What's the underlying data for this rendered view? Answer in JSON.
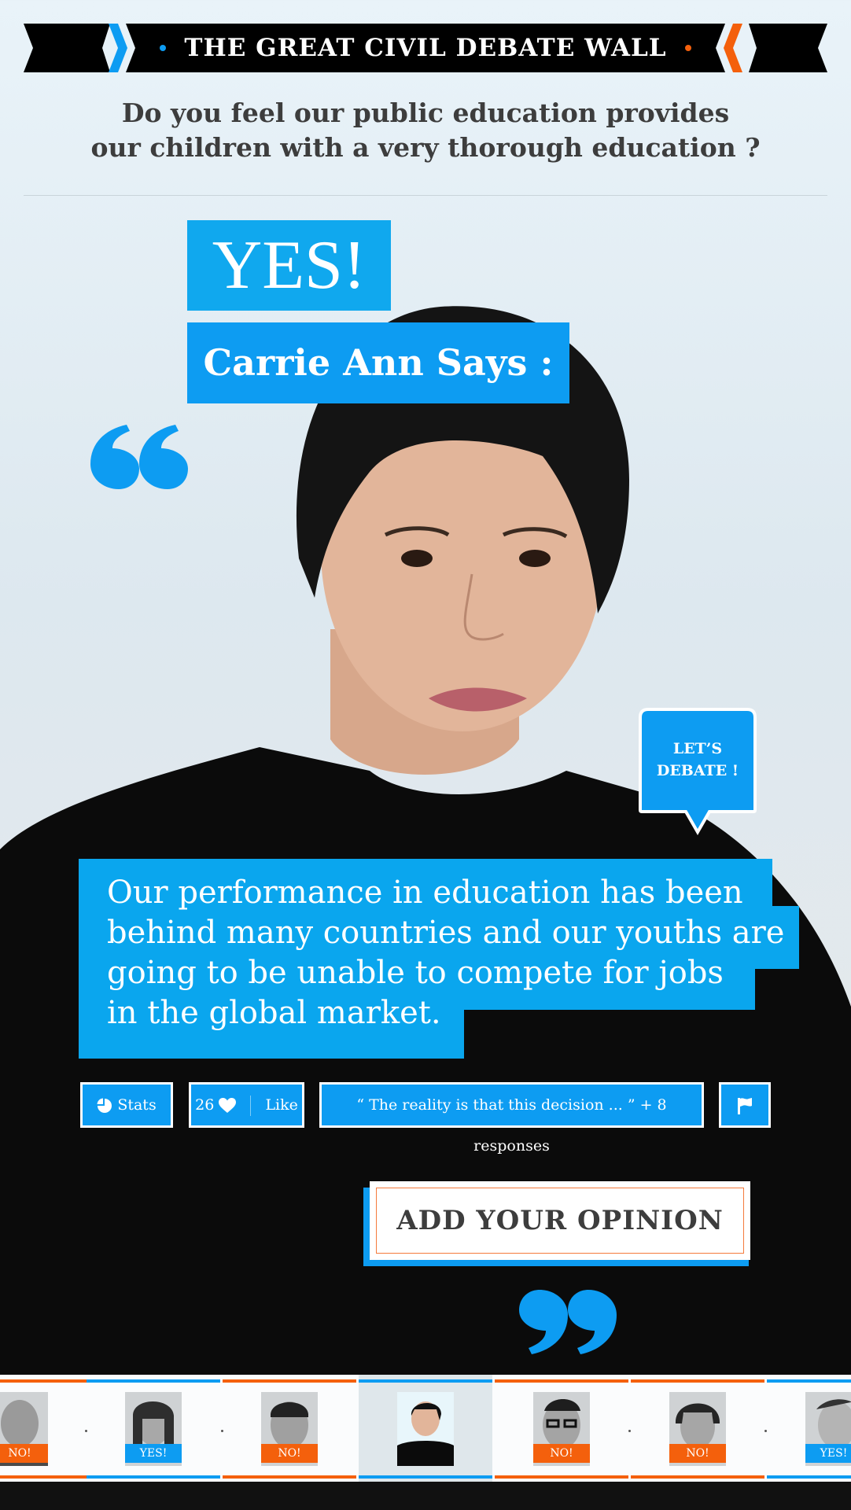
{
  "header": {
    "title": "THE GREAT CIVIL DEBATE WALL",
    "question_line1": "Do you feel our public education provides",
    "question_line2": "our children with a very thorough education ?"
  },
  "debate": {
    "stance": "YES!",
    "speaker": "Carrie Ann Says :",
    "opinion_line1": "Our performance in education has been",
    "opinion_line2": "behind many countries and our youths are",
    "opinion_line3": "going to be unable to compete for jobs",
    "opinion_line4": "in the global market.",
    "debate_bubble_line1": "LET’S",
    "debate_bubble_line2": "DEBATE !"
  },
  "actions": {
    "stats_label": "Stats",
    "like_count": "26",
    "like_label": "Like",
    "responses_label": "“ The reality is that this decision ... ” + 8 responses",
    "add_opinion_label": "ADD YOUR OPINION"
  },
  "thumbnails": [
    {
      "badge": "NO!",
      "stance": "no"
    },
    {
      "badge": "YES!",
      "stance": "yes"
    },
    {
      "badge": "NO!",
      "stance": "no"
    },
    {
      "badge": "",
      "stance": "active"
    },
    {
      "badge": "NO!",
      "stance": "no"
    },
    {
      "badge": "NO!",
      "stance": "no"
    },
    {
      "badge": "YES!",
      "stance": "yes"
    }
  ],
  "colors": {
    "accent_blue": "#0d9cf2",
    "accent_orange": "#f4600c",
    "text_dark": "#3d3d3d",
    "banner_black": "#000000"
  },
  "icons": [
    "stats-pie-icon",
    "heart-icon",
    "flag-icon",
    "quote-open-icon",
    "quote-close-icon"
  ]
}
